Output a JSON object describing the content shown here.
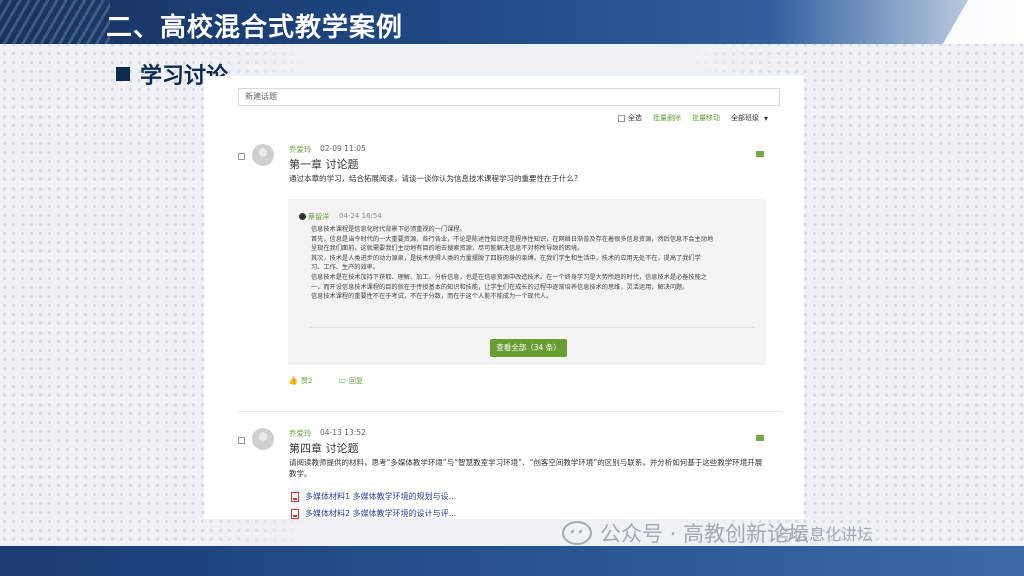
{
  "slide": {
    "title": "二、高校混合式教学案例",
    "section": "学习讨论"
  },
  "panel": {
    "search_placeholder": "新建话题",
    "toolbar": {
      "select_all": "全选",
      "batch_delete": "批量删除",
      "batch_move": "批量移动",
      "class_filter": "全部班级"
    },
    "posts": [
      {
        "author": "乔爱玲",
        "time": "02-09 11:05",
        "title": "第一章 讨论题",
        "question": "通过本章的学习，结合拓展阅读，请谈一谈你认为信息技术课程学习的重要性在于什么?",
        "reply": {
          "author": "蔡留洋",
          "time": "04-24 16:54",
          "lines": [
            "信息技术课程是信息化时代背景下必须重视的一门课程。",
            "首先，信息是当今时代的一大重要资源，各行各业，不论是陈述性知识还是程序性知识，在网络日渐普及存在着很多信息资源，然后信息不会主动地",
            "呈现在我们面前，这就需要我们主动地有目的地去搜索资源，尽可能解决信息不对称所导致的困境。",
            "其次，技术是人类进步的动力源泉，是技术使得人类的力量摆脱了四肢肉身的束缚。在我们学生和生活中，技术的应用无处不在，提高了我们学",
            "习、工作、生产的效率。",
            "信息技术是在技术加持下获取、理解、加工、分析信息，也是在信息资源中改造技术。在一个终身学习是大势所趋的时代，信息技术是必备技能之",
            "一，而开设信息技术课程的目的就在于传授基本的知识和技能，让学生们在成长的过程中逐渐培养信息技术的思维，灵活运用，解决问题。",
            "信息技术课程的重要性不在于考试，不在于分数，而在于这个人能不能成为一个现代人。"
          ],
          "view_all": "查看全部（34 条）"
        },
        "likes": "赞2",
        "reply_label": "回复"
      },
      {
        "author": "乔爱玲",
        "time": "04-13 13:52",
        "title": "第四章 讨论题",
        "question": "请阅读教师提供的材料，思考“多媒体教学环境”与“智慧教室学习环境”、“创客空间教学环境”的区别与联系，并分析如何基于这些教学环境开展教学。",
        "attachments": [
          "多媒体材料1 多媒体教学环境的规划与设...",
          "多媒体材料2 多媒体教学环境的设计与评..."
        ]
      }
    ]
  },
  "watermark": {
    "text": "公众号 · 高教创新论坛",
    "overlay": "与信息化讲坛"
  }
}
